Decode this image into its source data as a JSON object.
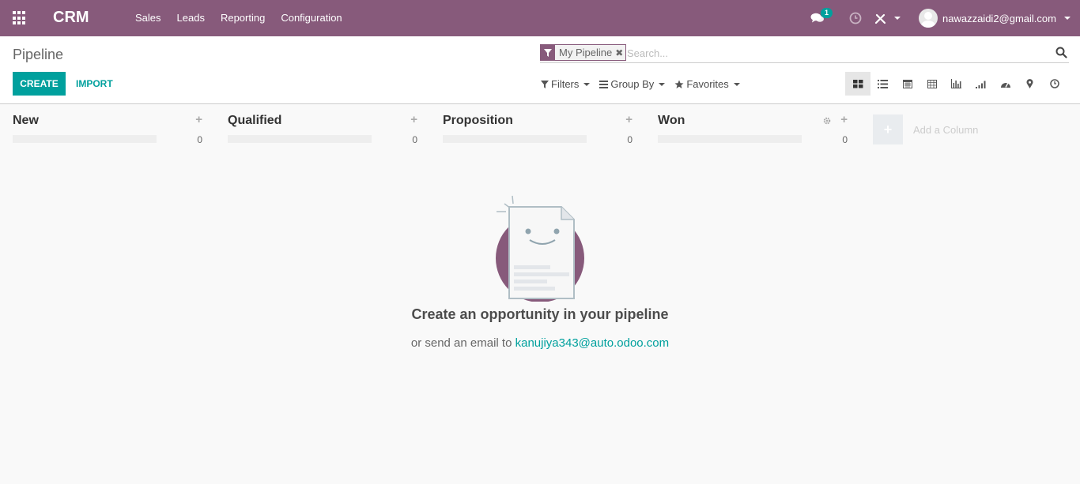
{
  "navbar": {
    "brand": "CRM",
    "menu": [
      "Sales",
      "Leads",
      "Reporting",
      "Configuration"
    ],
    "chat_badge": "1",
    "user_email": "nawazzaidi2@gmail.com",
    "bg_color": "#875a7b"
  },
  "control_panel": {
    "breadcrumb": "Pipeline",
    "create_label": "CREATE",
    "import_label": "IMPORT",
    "search": {
      "facet_label": "My Pipeline",
      "placeholder": "Search..."
    },
    "filters_label": "Filters",
    "groupby_label": "Group By",
    "favorites_label": "Favorites",
    "views": [
      "kanban-icon",
      "list-icon",
      "calendar-icon",
      "pivot-icon",
      "graph-icon",
      "cohort-icon",
      "dashboard-icon",
      "map-icon",
      "activity-icon"
    ],
    "active_view": "kanban"
  },
  "kanban": {
    "columns": [
      {
        "title": "New",
        "count": "0"
      },
      {
        "title": "Qualified",
        "count": "0"
      },
      {
        "title": "Proposition",
        "count": "0"
      },
      {
        "title": "Won",
        "count": "0"
      }
    ],
    "add_column_label": "Add a Column"
  },
  "help": {
    "title": "Create an opportunity in your pipeline",
    "subtitle_prefix": "or send an email to",
    "email": "kanujiya343@auto.odoo.com"
  },
  "colors": {
    "primary": "#875a7b",
    "accent": "#00a09d"
  }
}
